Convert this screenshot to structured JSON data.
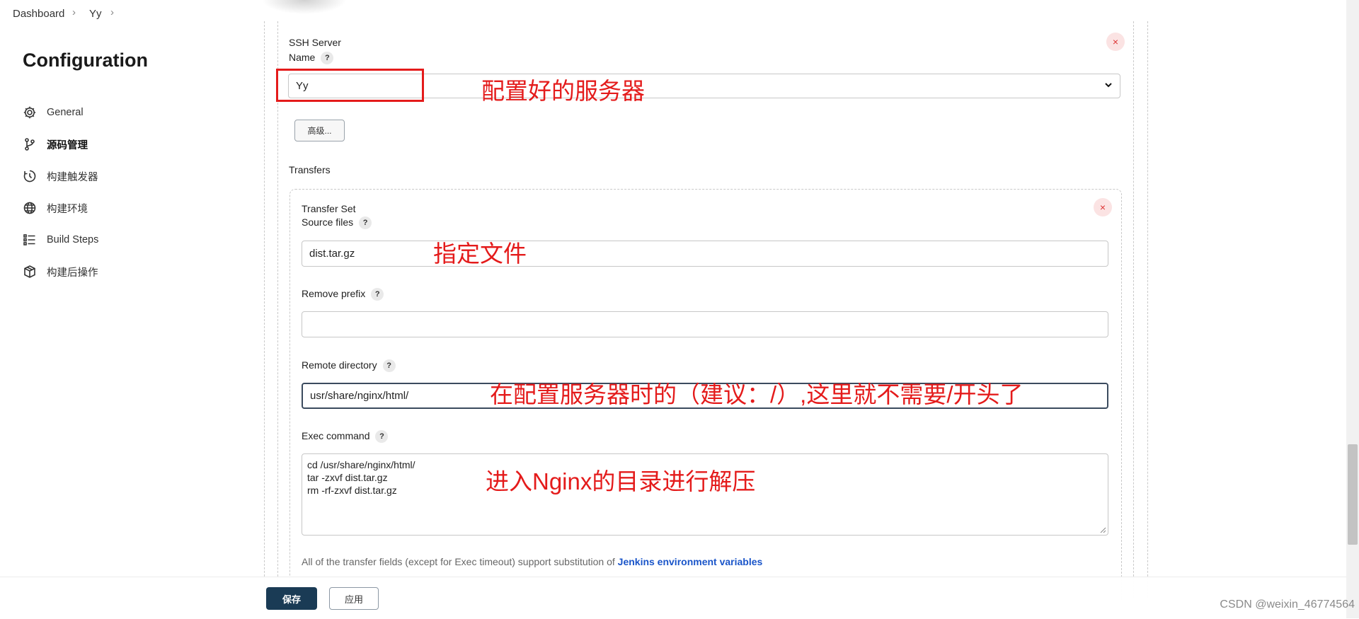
{
  "breadcrumb": {
    "items": [
      "Dashboard",
      "Yy"
    ]
  },
  "page_title": "Configuration",
  "sidebar": {
    "items": [
      {
        "label": "General",
        "icon": "gear-icon",
        "active": false
      },
      {
        "label": "源码管理",
        "icon": "branch-icon",
        "active": true
      },
      {
        "label": "构建触发器",
        "icon": "clock-icon",
        "active": false
      },
      {
        "label": "构建环境",
        "icon": "globe-icon",
        "active": false
      },
      {
        "label": "Build Steps",
        "icon": "list-icon",
        "active": false
      },
      {
        "label": "构建后操作",
        "icon": "package-icon",
        "active": false
      }
    ]
  },
  "ssh_server": {
    "section_label": "SSH Server",
    "name_label": "Name",
    "name_value": "Yy",
    "advanced_button": "高级...",
    "transfers_label": "Transfers"
  },
  "transfer_set": {
    "title": "Transfer Set",
    "source_files_label": "Source files",
    "source_files_value": "dist.tar.gz",
    "remove_prefix_label": "Remove prefix",
    "remove_prefix_value": "",
    "remote_directory_label": "Remote directory",
    "remote_directory_value": "usr/share/nginx/html/",
    "exec_command_label": "Exec command",
    "exec_command_lines": [
      "cd /usr/share/nginx/html/",
      "tar -zxvf dist.tar.gz",
      "rm -rf-zxvf dist.tar.gz"
    ],
    "footnote_text": "All of the transfer fields (except for Exec timeout) support substitution of",
    "footnote_link": "Jenkins environment variables"
  },
  "annotations": {
    "server": "配置好的服务器",
    "source": "指定文件",
    "remote": "在配置服务器时的（建议：/）,这里就不需要/开头了",
    "exec": "进入Nginx的目录进行解压"
  },
  "help_symbol": "?",
  "close_symbol": "×",
  "buttons": {
    "save": "保存",
    "apply": "应用"
  },
  "watermark": "CSDN @weixin_46774564",
  "colors": {
    "annotation_red": "#e41b1b",
    "save_button": "#1a3b55",
    "link_blue": "#1a55c9"
  }
}
